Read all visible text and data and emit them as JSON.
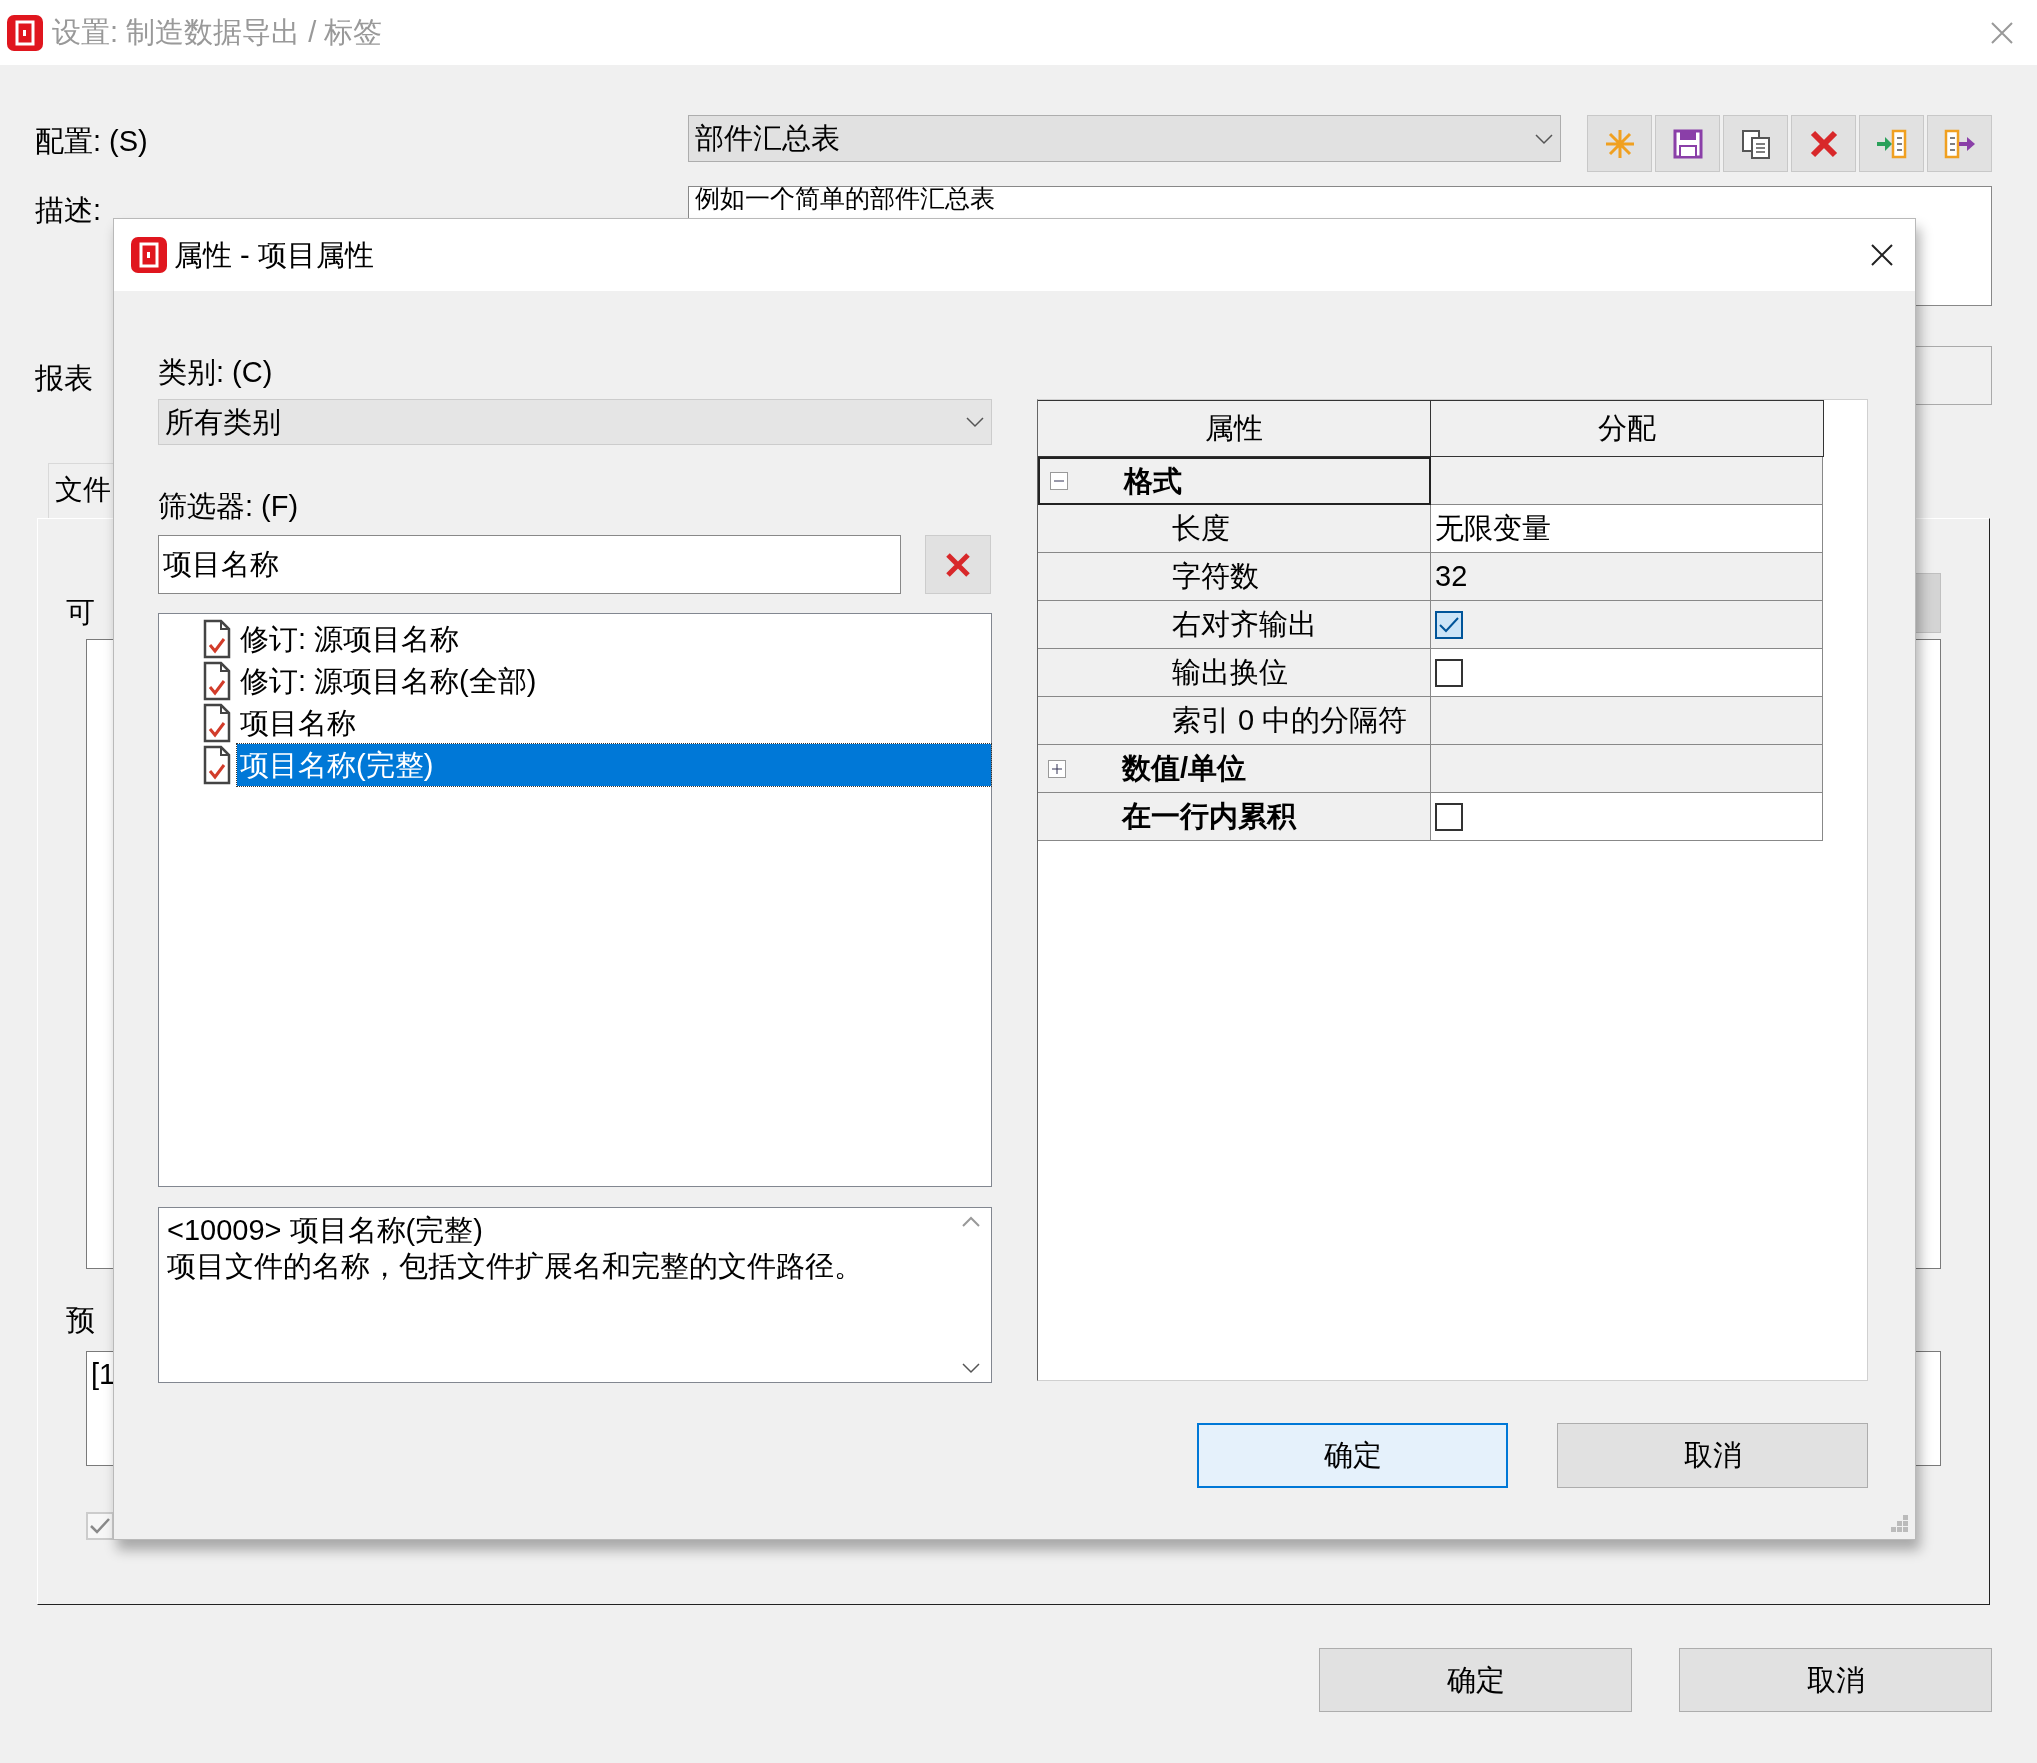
{
  "main_window": {
    "title": "设置: 制造数据导出 / 标签",
    "config": {
      "label": "配置: (S)",
      "value": "部件汇总表"
    },
    "toolbar": [
      {
        "kind": "new"
      },
      {
        "kind": "save"
      },
      {
        "kind": "copy"
      },
      {
        "kind": "delete"
      },
      {
        "kind": "import"
      },
      {
        "kind": "export"
      }
    ],
    "description": {
      "label": "描述:",
      "value": "例如一个简单的部件汇总表"
    },
    "report_type": {
      "label": "报表"
    },
    "tabs": [
      {
        "label": "文件",
        "selected": true
      }
    ],
    "available_label": "可",
    "preview": {
      "label": "预",
      "value": "[1"
    },
    "option_checkbox": {
      "checked": true,
      "disabled": true
    },
    "buttons": [
      "确定",
      "取消"
    ]
  },
  "dialog": {
    "title": "属性 - 项目属性",
    "category": {
      "label": "类别: (C)",
      "value": "所有类别"
    },
    "filter": {
      "label": "筛选器: (F)",
      "value": "项目名称"
    },
    "items": [
      {
        "label": "修订: 源项目名称",
        "selected": false
      },
      {
        "label": "修订: 源项目名称(全部)",
        "selected": false
      },
      {
        "label": "项目名称",
        "selected": false
      },
      {
        "label": "项目名称(完整)",
        "selected": true
      }
    ],
    "info": [
      "<10009> 项目名称(完整)",
      "项目文件的名称，包括文件扩展名和完整的文件路径。"
    ],
    "grid": {
      "columns": [
        "属性",
        "分配"
      ],
      "rows": [
        {
          "kind": "group",
          "label": "格式",
          "expanded": true,
          "selected": true,
          "children": [
            {
              "kind": "text",
              "label": "长度",
              "value": "无限变量",
              "readonly": false
            },
            {
              "kind": "text",
              "label": "字符数",
              "value": "32",
              "readonly": true
            },
            {
              "kind": "checkbox",
              "label": "右对齐输出",
              "checked": true,
              "readonly": true
            },
            {
              "kind": "checkbox",
              "label": "输出换位",
              "checked": false,
              "readonly": false
            },
            {
              "kind": "text",
              "label": "索引 0 中的分隔符",
              "readonly": true
            }
          ]
        },
        {
          "kind": "group",
          "label": "数值/单位",
          "expanded": false,
          "selected": false
        },
        {
          "kind": "checkbox",
          "label": "在一行内累积",
          "checked": false,
          "readonly": false,
          "selected": false
        }
      ]
    },
    "buttons": [
      {
        "label": "确定",
        "default": true
      },
      {
        "label": "取消",
        "default": false
      }
    ]
  }
}
